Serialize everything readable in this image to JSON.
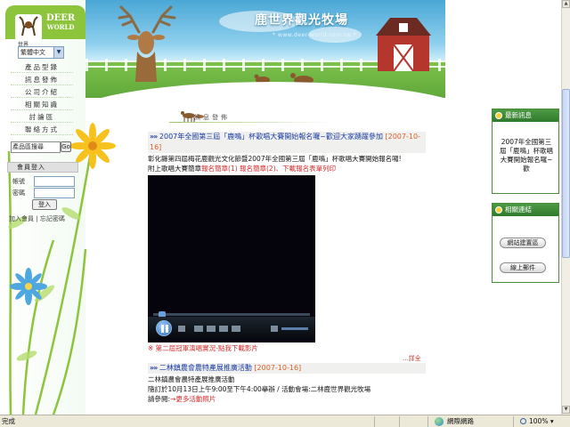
{
  "header": {
    "site_title": "鹿世界觀光牧場",
    "site_url": "* www.deer-world.com.tw *"
  },
  "logo": {
    "line1": "DEER",
    "line2": "WORLD",
    "sub": "世界"
  },
  "language": {
    "selected": "繁體中文"
  },
  "left_menu": [
    {
      "label": "產品型錄"
    },
    {
      "label": "訊息發佈"
    },
    {
      "label": "公司介紹"
    },
    {
      "label": "相關知識"
    },
    {
      "label": "討論區"
    },
    {
      "label": "聯絡方式"
    }
  ],
  "product_search": {
    "label": "產品區搜尋",
    "button": "Go"
  },
  "member": {
    "title": "會員登入",
    "account_label": "帳號",
    "password_label": "密碼",
    "login_button": "登入",
    "join_link": "加入會員",
    "forgot_link": "忘記密碼"
  },
  "content": {
    "section_title": "訊息發佈",
    "news": [
      {
        "title": "2007年全國第三屆「鹿鳴」杯歌唱大賽開始報名囉~歡迎大家踴躍參加",
        "date": "[2007-10-16]",
        "body_line1": "彰化縣第四屆梅花鹿觀光文化節暨2007年全國第三屆「鹿鳴」杯歌唱大賽開始報名囉!",
        "body_line2_prefix": "附上歌唱大賽簡章",
        "body_line2_links": "報名簡章(1) 報名簡章(2)、下載報名表單列印",
        "video_caption": "※ 第二屆冠軍演唱實況-點我下載影片"
      },
      {
        "title": "二林鎮農會農特產展推廣活動",
        "date": "[2007-10-16]",
        "body_line1": "二林鎮農會農特產展推廣活動",
        "body_line2": "隨訂於10月13日上午9:00至下午4:00舉辦 / 活動會場:二林鹿世界觀光牧場",
        "body_line3_prefix": "請參閱:",
        "body_line3_link": "→更多活動照片"
      }
    ],
    "more_link": "...詳全文"
  },
  "right_panel": {
    "latest_title": "最新訊息",
    "latest_text": "2007年全國第三屆「鹿鳴」杯歌唱大賽開始報名囉~歡",
    "links_title": "相關連結",
    "link_buttons": [
      "網站建置區",
      "線上郵件"
    ]
  },
  "status_bar": {
    "left": "完成",
    "zone": "網際網路",
    "zoom": "100%"
  },
  "colors": {
    "accent_green": "#2f7a2c",
    "news_title_blue": "#1a3aa0",
    "date_orange": "#d8602a",
    "link_red": "#d12b2b"
  }
}
